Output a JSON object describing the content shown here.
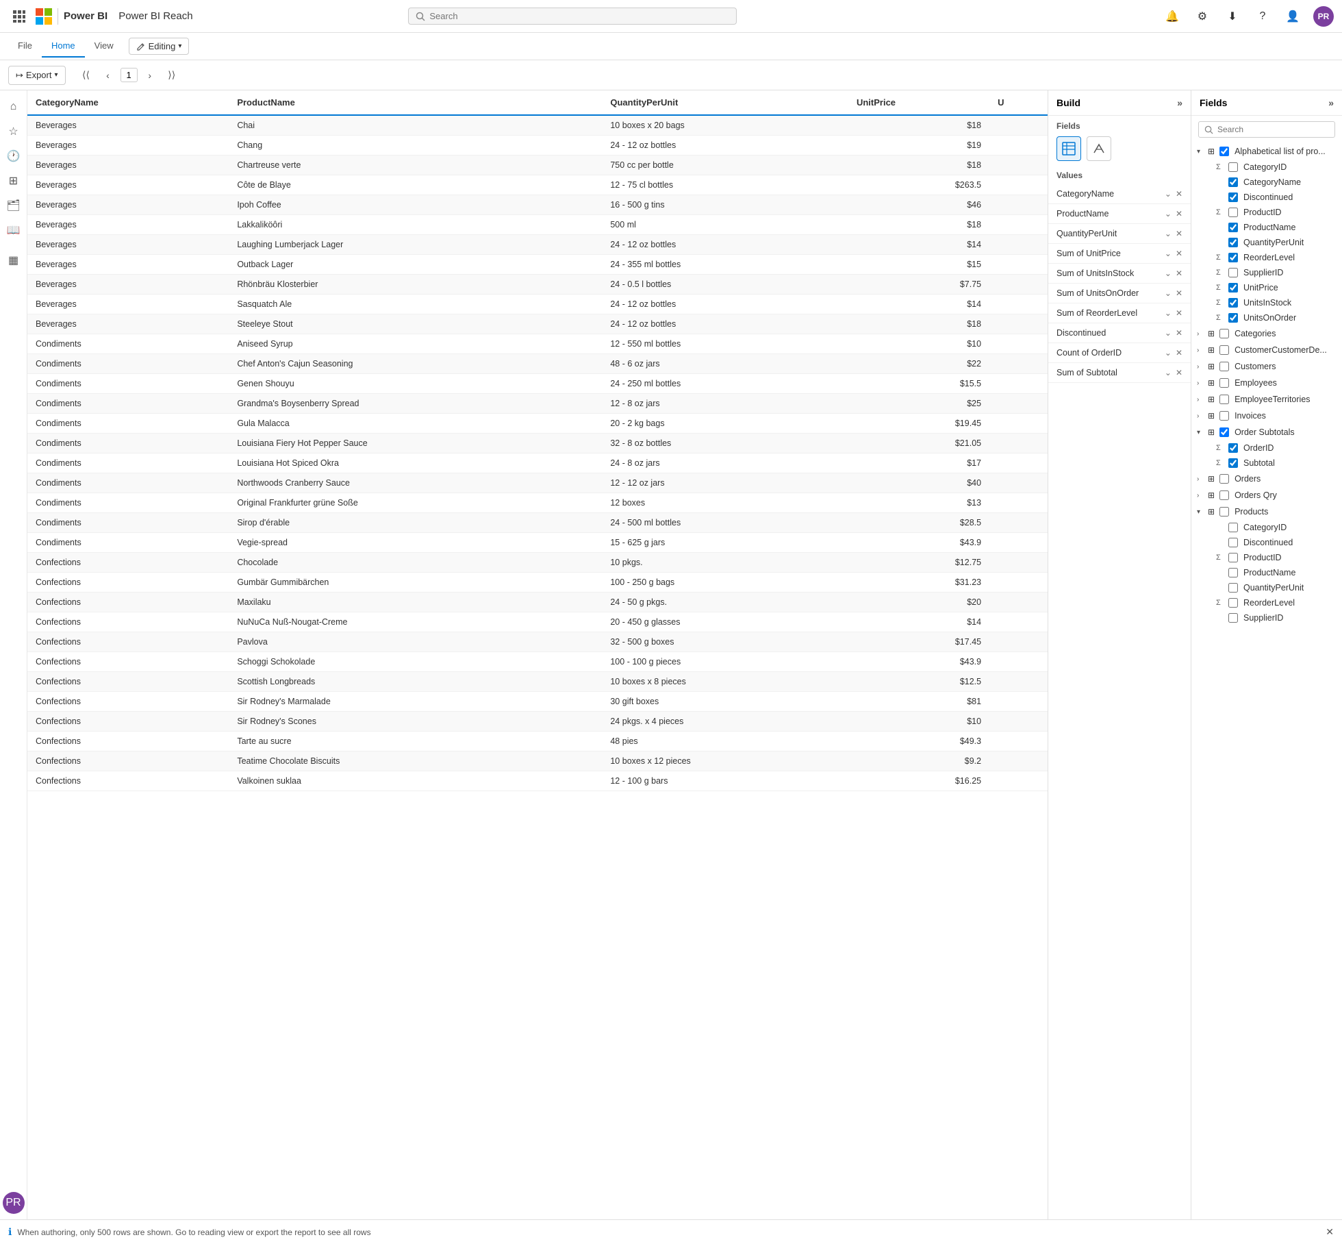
{
  "topnav": {
    "app_name": "Power BI",
    "report_name": "Power BI Reach",
    "search_placeholder": "Search",
    "avatar_initials": "PR"
  },
  "ribbon": {
    "tabs": [
      "File",
      "Home",
      "View"
    ],
    "active_tab": "Home",
    "editing_label": "Editing"
  },
  "toolbar": {
    "export_label": "Export",
    "page_number": "1"
  },
  "build_panel": {
    "title": "Build",
    "expand_icon": "»",
    "fields_label": "Fields",
    "values_label": "Values",
    "value_items": [
      "CategoryName",
      "ProductName",
      "QuantityPerUnit",
      "Sum of UnitPrice",
      "Sum of UnitsInStock",
      "Sum of UnitsOnOrder",
      "Sum of ReorderLevel",
      "Discontinued",
      "Count of OrderID",
      "Sum of Subtotal"
    ]
  },
  "fields_panel": {
    "title": "Fields",
    "expand_icon": "»",
    "search_placeholder": "Search",
    "groups": [
      {
        "name": "Alphabetical list of pro...",
        "expanded": true,
        "items": [
          {
            "label": "CategoryID",
            "checked": false,
            "is_measure": true
          },
          {
            "label": "CategoryName",
            "checked": true,
            "is_measure": false
          },
          {
            "label": "Discontinued",
            "checked": true,
            "is_measure": false
          },
          {
            "label": "ProductID",
            "checked": false,
            "is_measure": true
          },
          {
            "label": "ProductName",
            "checked": true,
            "is_measure": false
          },
          {
            "label": "QuantityPerUnit",
            "checked": true,
            "is_measure": false
          },
          {
            "label": "ReorderLevel",
            "checked": true,
            "is_measure": true
          },
          {
            "label": "SupplierID",
            "checked": false,
            "is_measure": true
          },
          {
            "label": "UnitPrice",
            "checked": true,
            "is_measure": true
          },
          {
            "label": "UnitsInStock",
            "checked": true,
            "is_measure": true
          },
          {
            "label": "UnitsOnOrder",
            "checked": true,
            "is_measure": true
          }
        ]
      },
      {
        "name": "Categories",
        "expanded": false,
        "items": []
      },
      {
        "name": "CustomerCustomerDe...",
        "expanded": false,
        "items": []
      },
      {
        "name": "Customers",
        "expanded": false,
        "items": []
      },
      {
        "name": "Employees",
        "expanded": false,
        "items": []
      },
      {
        "name": "EmployeeTerritories",
        "expanded": false,
        "items": []
      },
      {
        "name": "Invoices",
        "expanded": false,
        "items": []
      },
      {
        "name": "Order Subtotals",
        "expanded": true,
        "items": [
          {
            "label": "OrderID",
            "checked": true,
            "is_measure": true
          },
          {
            "label": "Subtotal",
            "checked": true,
            "is_measure": true
          }
        ]
      },
      {
        "name": "Orders",
        "expanded": false,
        "items": []
      },
      {
        "name": "Orders Qry",
        "expanded": false,
        "items": []
      },
      {
        "name": "Products",
        "expanded": true,
        "items": [
          {
            "label": "CategoryID",
            "checked": false,
            "is_measure": false
          },
          {
            "label": "Discontinued",
            "checked": false,
            "is_measure": false
          },
          {
            "label": "ProductID",
            "checked": false,
            "is_measure": true
          },
          {
            "label": "ProductName",
            "checked": false,
            "is_measure": false
          },
          {
            "label": "QuantityPerUnit",
            "checked": false,
            "is_measure": false
          },
          {
            "label": "ReorderLevel",
            "checked": false,
            "is_measure": true
          },
          {
            "label": "SupplierID",
            "checked": false,
            "is_measure": false
          }
        ]
      }
    ]
  },
  "table": {
    "columns": [
      "CategoryName",
      "ProductName",
      "QuantityPerUnit",
      "UnitPrice",
      "U"
    ],
    "rows": [
      {
        "category": "Beverages",
        "product": "Chai",
        "qty": "10 boxes x 20 bags",
        "price": "$18",
        "u": ""
      },
      {
        "category": "Beverages",
        "product": "Chang",
        "qty": "24 - 12 oz bottles",
        "price": "$19",
        "u": ""
      },
      {
        "category": "Beverages",
        "product": "Chartreuse verte",
        "qty": "750 cc per bottle",
        "price": "$18",
        "u": ""
      },
      {
        "category": "Beverages",
        "product": "Côte de Blaye",
        "qty": "12 - 75 cl bottles",
        "price": "$263.5",
        "u": ""
      },
      {
        "category": "Beverages",
        "product": "Ipoh Coffee",
        "qty": "16 - 500 g tins",
        "price": "$46",
        "u": ""
      },
      {
        "category": "Beverages",
        "product": "Lakkaliköôri",
        "qty": "500 ml",
        "price": "$18",
        "u": ""
      },
      {
        "category": "Beverages",
        "product": "Laughing Lumberjack Lager",
        "qty": "24 - 12 oz bottles",
        "price": "$14",
        "u": ""
      },
      {
        "category": "Beverages",
        "product": "Outback Lager",
        "qty": "24 - 355 ml bottles",
        "price": "$15",
        "u": ""
      },
      {
        "category": "Beverages",
        "product": "Rhönbräu Klosterbier",
        "qty": "24 - 0.5 l bottles",
        "price": "$7.75",
        "u": ""
      },
      {
        "category": "Beverages",
        "product": "Sasquatch Ale",
        "qty": "24 - 12 oz bottles",
        "price": "$14",
        "u": ""
      },
      {
        "category": "Beverages",
        "product": "Steeleye Stout",
        "qty": "24 - 12 oz bottles",
        "price": "$18",
        "u": ""
      },
      {
        "category": "Condiments",
        "product": "Aniseed Syrup",
        "qty": "12 - 550 ml bottles",
        "price": "$10",
        "u": ""
      },
      {
        "category": "Condiments",
        "product": "Chef Anton's Cajun Seasoning",
        "qty": "48 - 6 oz jars",
        "price": "$22",
        "u": ""
      },
      {
        "category": "Condiments",
        "product": "Genen Shouyu",
        "qty": "24 - 250 ml bottles",
        "price": "$15.5",
        "u": ""
      },
      {
        "category": "Condiments",
        "product": "Grandma's Boysenberry Spread",
        "qty": "12 - 8 oz jars",
        "price": "$25",
        "u": ""
      },
      {
        "category": "Condiments",
        "product": "Gula Malacca",
        "qty": "20 - 2 kg bags",
        "price": "$19.45",
        "u": ""
      },
      {
        "category": "Condiments",
        "product": "Louisiana Fiery Hot Pepper Sauce",
        "qty": "32 - 8 oz bottles",
        "price": "$21.05",
        "u": ""
      },
      {
        "category": "Condiments",
        "product": "Louisiana Hot Spiced Okra",
        "qty": "24 - 8 oz jars",
        "price": "$17",
        "u": ""
      },
      {
        "category": "Condiments",
        "product": "Northwoods Cranberry Sauce",
        "qty": "12 - 12 oz jars",
        "price": "$40",
        "u": ""
      },
      {
        "category": "Condiments",
        "product": "Original Frankfurter grüne Soße",
        "qty": "12 boxes",
        "price": "$13",
        "u": ""
      },
      {
        "category": "Condiments",
        "product": "Sirop d'érable",
        "qty": "24 - 500 ml bottles",
        "price": "$28.5",
        "u": ""
      },
      {
        "category": "Condiments",
        "product": "Vegie-spread",
        "qty": "15 - 625 g jars",
        "price": "$43.9",
        "u": ""
      },
      {
        "category": "Confections",
        "product": "Chocolade",
        "qty": "10 pkgs.",
        "price": "$12.75",
        "u": ""
      },
      {
        "category": "Confections",
        "product": "Gumbär Gummibärchen",
        "qty": "100 - 250 g bags",
        "price": "$31.23",
        "u": ""
      },
      {
        "category": "Confections",
        "product": "Maxilaku",
        "qty": "24 - 50 g pkgs.",
        "price": "$20",
        "u": ""
      },
      {
        "category": "Confections",
        "product": "NuNuCa Nuß-Nougat-Creme",
        "qty": "20 - 450 g glasses",
        "price": "$14",
        "u": ""
      },
      {
        "category": "Confections",
        "product": "Pavlova",
        "qty": "32 - 500 g boxes",
        "price": "$17.45",
        "u": ""
      },
      {
        "category": "Confections",
        "product": "Schoggi Schokolade",
        "qty": "100 - 100 g pieces",
        "price": "$43.9",
        "u": ""
      },
      {
        "category": "Confections",
        "product": "Scottish Longbreads",
        "qty": "10 boxes x 8 pieces",
        "price": "$12.5",
        "u": ""
      },
      {
        "category": "Confections",
        "product": "Sir Rodney's Marmalade",
        "qty": "30 gift boxes",
        "price": "$81",
        "u": ""
      },
      {
        "category": "Confections",
        "product": "Sir Rodney's Scones",
        "qty": "24 pkgs. x 4 pieces",
        "price": "$10",
        "u": ""
      },
      {
        "category": "Confections",
        "product": "Tarte au sucre",
        "qty": "48 pies",
        "price": "$49.3",
        "u": ""
      },
      {
        "category": "Confections",
        "product": "Teatime Chocolate Biscuits",
        "qty": "10 boxes x 12 pieces",
        "price": "$9.2",
        "u": ""
      },
      {
        "category": "Confections",
        "product": "Valkoinen suklaa",
        "qty": "12 - 100 g bars",
        "price": "$16.25",
        "u": ""
      }
    ]
  },
  "bottom_bar": {
    "message": "When authoring, only 500 rows are shown. Go to reading view or export the report to see all rows"
  }
}
